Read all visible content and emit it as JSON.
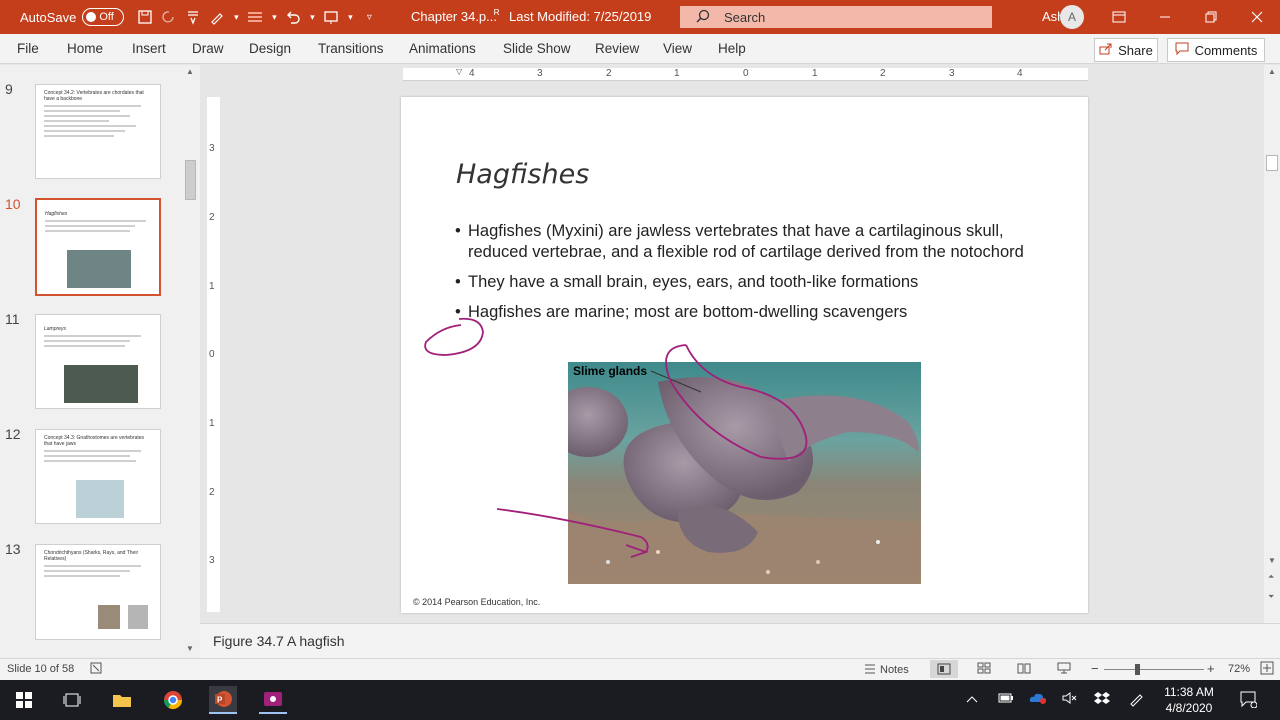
{
  "titlebar": {
    "autosave_label": "AutoSave",
    "autosave_state": "Off",
    "document_title": "Chapter 34.p...",
    "last_modified": "Last Modified: 7/25/2019",
    "search_placeholder": "Search",
    "user_name": "Ashley",
    "user_initial": "A"
  },
  "menu": {
    "items": [
      "File",
      "Home",
      "Insert",
      "Draw",
      "Design",
      "Transitions",
      "Animations",
      "Slide Show",
      "Review",
      "View",
      "Help"
    ],
    "share_label": "Share",
    "comments_label": "Comments"
  },
  "thumbnails": [
    {
      "number": "9",
      "title": "Concept 34.2: Vertebrates are chordates that have a backbone"
    },
    {
      "number": "10",
      "title": "Hagfishes",
      "selected": true
    },
    {
      "number": "11",
      "title": "Lampreys"
    },
    {
      "number": "12",
      "title": "Concept 34.3: Gnathostomes are vertebrates that have jaws"
    },
    {
      "number": "13",
      "title": "Chondrichthyans (Sharks, Rays, and Their Relatives)"
    }
  ],
  "ruler": {
    "top_ticks": [
      "4",
      "3",
      "2",
      "1",
      "0",
      "1",
      "2",
      "3",
      "4"
    ],
    "left_ticks": [
      "3",
      "2",
      "1",
      "0",
      "1",
      "2",
      "3"
    ]
  },
  "slide": {
    "title": "Hagfishes",
    "bullets": [
      "Hagfishes (Myxini) are jawless vertebrates that have a cartilaginous skull, reduced vertebrae, and a flexible rod of cartilage derived from the notochord",
      "They have a small brain, eyes, ears, and tooth-like formations",
      "Hagfishes are marine; most are bottom-dwelling scavengers"
    ],
    "image_label": "Slime glands",
    "copyright": "© 2014 Pearson Education, Inc.",
    "ink_color": "#a0207a"
  },
  "notes": {
    "text": "Figure 34.7 A hagfish"
  },
  "status": {
    "slide_indicator": "Slide 10 of 58",
    "notes_label": "Notes",
    "zoom": "72%"
  },
  "taskbar": {
    "time": "11:38 AM",
    "date": "4/8/2020"
  },
  "colors": {
    "accent": "#c43e1c",
    "selection": "#d35230"
  }
}
